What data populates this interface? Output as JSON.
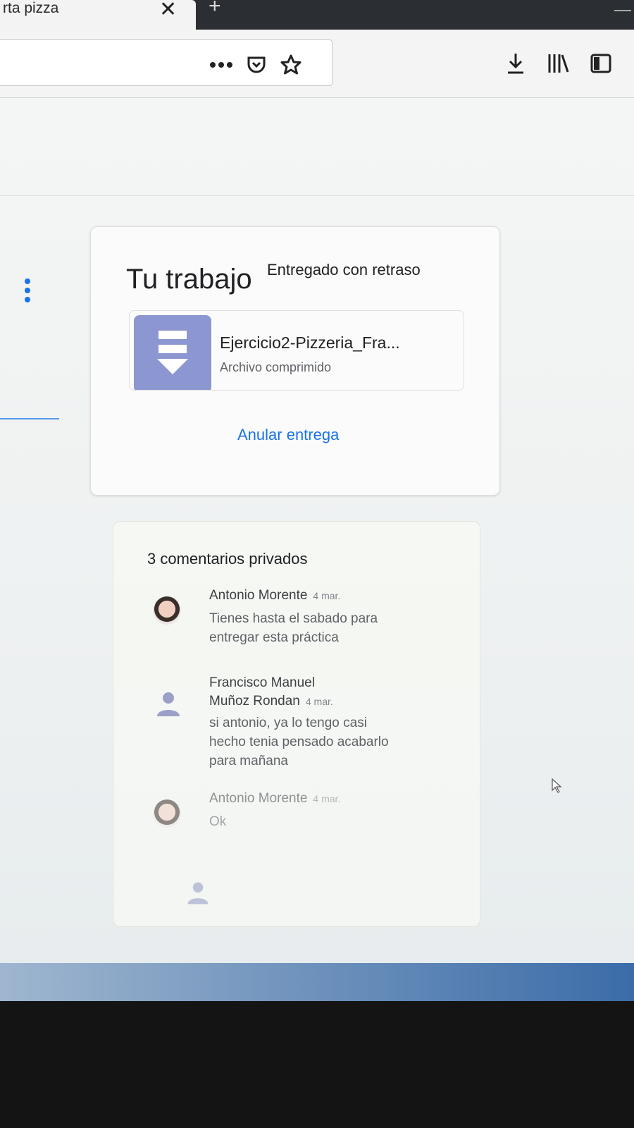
{
  "browser": {
    "tab_title": "rta pizza",
    "tab_close": "✕",
    "new_tab": "+",
    "url_actions": [
      "more-icon",
      "pocket-icon",
      "star-icon"
    ],
    "toolbar_right": [
      "download-icon",
      "library-icon",
      "sidebar-icon"
    ]
  },
  "work": {
    "title": "Tu trabajo",
    "status": "Entregado con retraso",
    "attachment": {
      "name": "Ejercicio2-Pizzeria_Fra...",
      "type": "Archivo comprimido",
      "icon": "zip-file-icon",
      "color": "#8c96d0"
    },
    "unsubmit_label": "Anular entrega"
  },
  "comments": {
    "title": "3 comentarios privados",
    "items": [
      {
        "author": "Antonio Morente",
        "date": "4 mar.",
        "text_lines": [
          "Tienes hasta el sabado para",
          "entregar esta práctica"
        ]
      },
      {
        "author_lines": [
          "Francisco Manuel",
          "Muñoz Rondan"
        ],
        "date": "4 mar.",
        "text_lines": [
          "si antonio, ya lo tengo casi",
          "hecho tenia pensado acabarlo",
          "para mañana"
        ]
      },
      {
        "author": "Antonio Morente",
        "date": "4 mar.",
        "text_lines": [
          "Ok"
        ]
      }
    ]
  },
  "colors": {
    "accent": "#1a73e8",
    "tabbar": "#2b2e33"
  }
}
